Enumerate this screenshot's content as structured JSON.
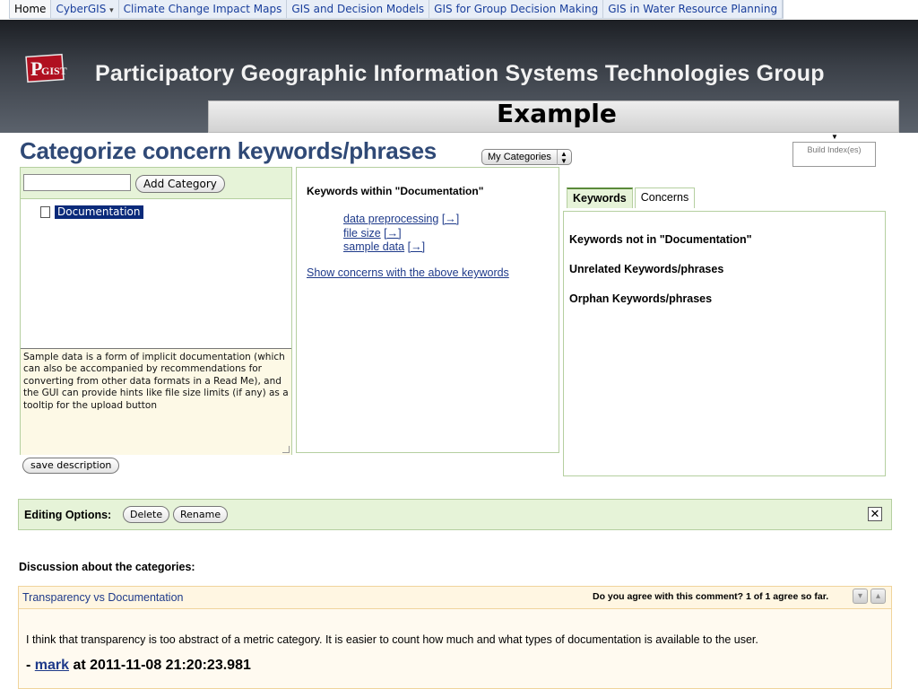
{
  "nav": {
    "items": [
      {
        "label": "Home"
      },
      {
        "label": "CyberGIS",
        "caret": "▾"
      },
      {
        "label": "Climate Change Impact Maps"
      },
      {
        "label": "GIS and Decision Models"
      },
      {
        "label": "GIS for Group Decision Making"
      },
      {
        "label": "GIS in Water Resource Planning"
      }
    ]
  },
  "header": {
    "logo_text": "PGIST",
    "group_title": "Participatory Geographic Information Systems Technologies Group",
    "slide_label": "Example"
  },
  "page": {
    "title": "Categorize concern keywords/phrases",
    "my_categories": "My Categories",
    "build_index": "Build Index(es)"
  },
  "left": {
    "input_value": "",
    "add_category": "Add Category",
    "tree_node": "Documentation",
    "description": "Sample data is a form of implicit documentation (which can also be accompanied by recommendations for converting from other data formats in a Read Me), and the GUI can provide hints like file size limits (if any) as a tooltip for the upload button",
    "save_description": "save description"
  },
  "middle": {
    "title": "Keywords within \"Documentation\"",
    "keywords": [
      {
        "label": "data preprocessing",
        "arrow": "[→]"
      },
      {
        "label": "file size",
        "arrow": "[→]"
      },
      {
        "label": "sample data",
        "arrow": "[→]"
      }
    ],
    "show_concerns": "Show concerns with the above keywords"
  },
  "right": {
    "tabs": [
      "Keywords",
      "Concerns"
    ],
    "lines": [
      "Keywords not in \"Documentation\"",
      "Unrelated Keywords/phrases",
      "Orphan Keywords/phrases"
    ]
  },
  "editing": {
    "label": "Editing Options:",
    "delete": "Delete",
    "rename": "Rename",
    "close": "✕"
  },
  "discussion": {
    "title": "Discussion about the categories:",
    "comment": {
      "title": "Transparency vs Documentation",
      "agree": "Do you agree with this comment? 1 of 1 agree so far.",
      "body": "I think that transparency is too abstract of a metric category. It is easier to count how much and what types of  documentation is available to the user.",
      "sig_prefix": "- ",
      "author": "mark",
      "sig_suffix": " at 2011-11-08 21:20:23.981"
    }
  },
  "colors": {
    "title_blue": "#2f4976",
    "link_blue": "#1e3a8a",
    "panel_green": "#e6f3d8",
    "panel_border": "#b5cfa0",
    "comment_border": "#f0d49c"
  }
}
